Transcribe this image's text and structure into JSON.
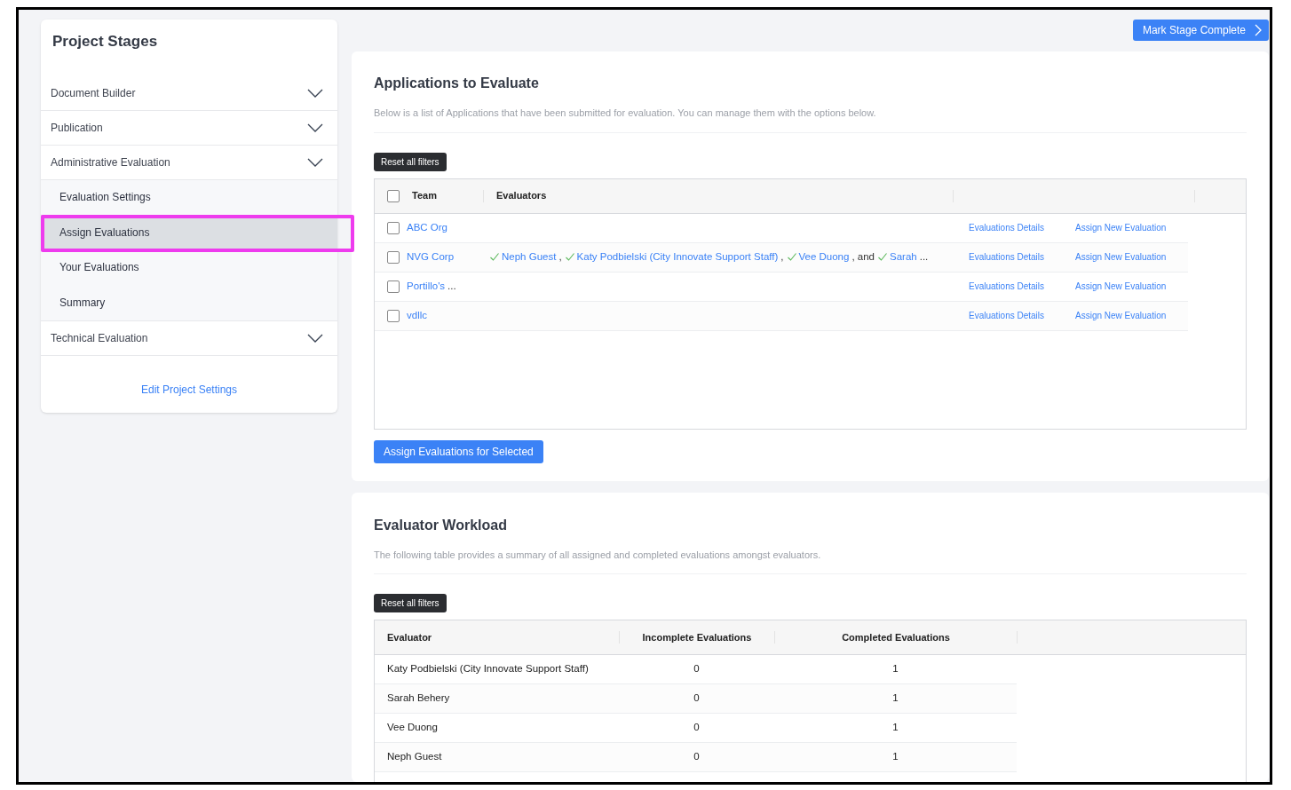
{
  "sidebar": {
    "title": "Project Stages",
    "sections": [
      {
        "label": "Document Builder"
      },
      {
        "label": "Publication"
      },
      {
        "label": "Administrative Evaluation",
        "children": [
          {
            "label": "Evaluation Settings",
            "selected": false,
            "highlighted": false
          },
          {
            "label": "Assign Evaluations",
            "selected": true,
            "highlighted": true
          },
          {
            "label": "Your Evaluations",
            "selected": false,
            "highlighted": false
          },
          {
            "label": "Summary",
            "selected": false,
            "highlighted": false
          }
        ]
      },
      {
        "label": "Technical Evaluation"
      }
    ],
    "footer_link": "Edit Project Settings"
  },
  "header_button": "Mark Stage Complete",
  "applications": {
    "title": "Applications to Evaluate",
    "description": "Below is a list of Applications that have been submitted for evaluation. You can manage them with the options below.",
    "reset_button": "Reset all filters",
    "columns": [
      "Team",
      "Evaluators"
    ],
    "header_checked": false,
    "rows": [
      {
        "team": "ABC Org",
        "checked": false,
        "evaluators": [],
        "details_link": "Evaluations Details",
        "assign_link": "Assign New Evaluation"
      },
      {
        "team": "NVG Corp",
        "checked": false,
        "evaluators": [
          {
            "kind": "name",
            "text": "Neph Guest",
            "done": true
          },
          {
            "kind": "sep",
            "text": ","
          },
          {
            "kind": "name",
            "text": "Katy Podbielski (City Innovate Support Staff)",
            "done": true
          },
          {
            "kind": "sep",
            "text": ","
          },
          {
            "kind": "name",
            "text": "Vee Duong",
            "done": true
          },
          {
            "kind": "sep",
            "text": ", and"
          },
          {
            "kind": "name",
            "text": "Sarah",
            "done": true
          },
          {
            "kind": "sep",
            "text": "..."
          }
        ],
        "details_link": "Evaluations Details",
        "assign_link": "Assign New Evaluation"
      },
      {
        "team": "Portillo's",
        "suffix": "...",
        "checked": false,
        "evaluators": [],
        "details_link": "Evaluations Details",
        "assign_link": "Assign New Evaluation"
      },
      {
        "team": "vdllc",
        "checked": false,
        "evaluators": [],
        "details_link": "Evaluations Details",
        "assign_link": "Assign New Evaluation"
      }
    ],
    "action_button": "Assign Evaluations for Selected"
  },
  "workload": {
    "title": "Evaluator Workload",
    "description": "The following table provides a summary of all assigned and completed evaluations amongst evaluators.",
    "reset_button": "Reset all filters",
    "columns": [
      "Evaluator",
      "Incomplete Evaluations",
      "Completed Evaluations"
    ],
    "rows": [
      {
        "evaluator": "Katy Podbielski (City Innovate Support Staff)",
        "incomplete": "0",
        "completed": "1"
      },
      {
        "evaluator": "Sarah Behery",
        "incomplete": "0",
        "completed": "1"
      },
      {
        "evaluator": "Vee Duong",
        "incomplete": "0",
        "completed": "1"
      },
      {
        "evaluator": "Neph Guest",
        "incomplete": "0",
        "completed": "1"
      }
    ]
  }
}
